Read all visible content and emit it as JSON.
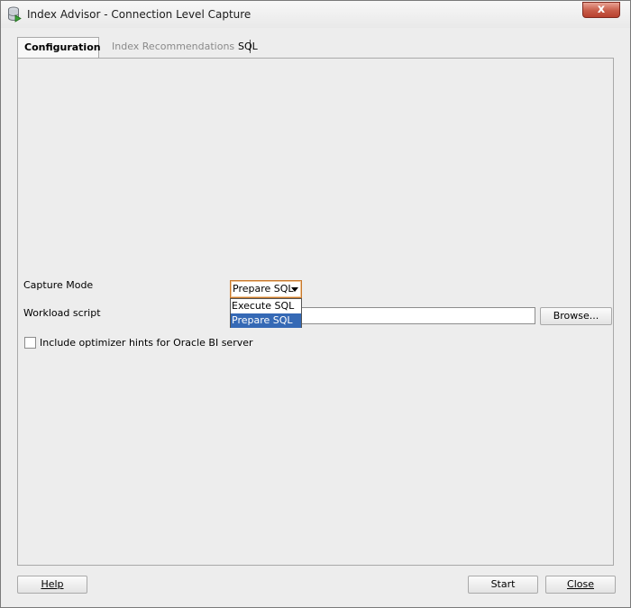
{
  "window": {
    "title": "Index Advisor - Connection Level Capture",
    "close_glyph": "x",
    "app_icon": "database-run-icon"
  },
  "tabs": [
    {
      "label": "Configuration",
      "active": true
    },
    {
      "label": "Index Recommendations",
      "active": false
    },
    {
      "label": "SQL",
      "active": false
    }
  ],
  "form": {
    "capture_mode_label": "Capture Mode",
    "capture_mode_value": "Prepare SQL",
    "capture_mode_options": [
      "Execute SQL",
      "Prepare SQL"
    ],
    "workload_script_label": "Workload script",
    "workload_script_value": "",
    "browse_label": "Browse...",
    "hints_checkbox_label": "Include optimizer hints for Oracle BI server",
    "hints_checked": false
  },
  "footer": {
    "help_label": "Help",
    "start_label": "Start",
    "close_label": "Close"
  }
}
